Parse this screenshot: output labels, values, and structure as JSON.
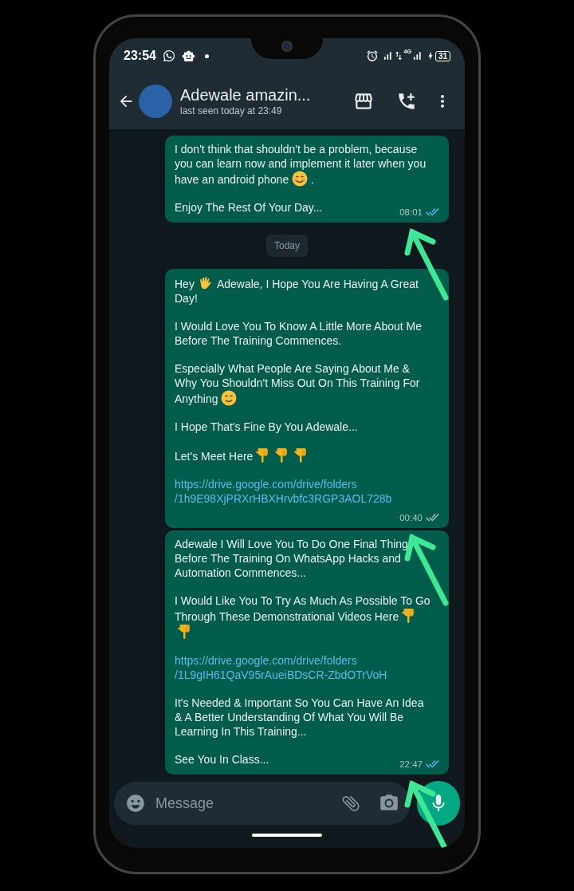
{
  "status_bar": {
    "time": "23:54",
    "network_type": "4G",
    "battery": "31"
  },
  "chat_header": {
    "contact_name": "Adewale amazin...",
    "last_seen": "last seen today at 23:49"
  },
  "messages": [
    {
      "kind": "message",
      "time": "08:01",
      "read": true,
      "paragraphs": [
        {
          "kind": "lines",
          "lines": [
            [
              {
                "kind": "text",
                "text": "I don't think that shouldn't be a problem, because"
              }
            ],
            [
              {
                "kind": "text",
                "text": "you can learn now and implement it later when you"
              }
            ],
            [
              {
                "kind": "text",
                "text": "have an android phone"
              },
              {
                "kind": "blush"
              },
              {
                "kind": "text",
                "text": "."
              }
            ]
          ]
        },
        {
          "kind": "text",
          "text": "Enjoy The Rest Of Your Day..."
        }
      ]
    },
    {
      "kind": "date",
      "label": "Today"
    },
    {
      "kind": "message",
      "time": "00:40",
      "read": false,
      "paragraphs": [
        {
          "kind": "lines",
          "lines": [
            [
              {
                "kind": "text",
                "text": "Hey"
              },
              {
                "kind": "wave"
              },
              {
                "kind": "text",
                "text": "Adewale, I Hope You Are Having A Great"
              }
            ],
            [
              {
                "kind": "text",
                "text": "Day!"
              }
            ]
          ]
        },
        {
          "kind": "text",
          "text": "I Would Love You To Know A Little More About Me Before The Training Commences."
        },
        {
          "kind": "lines",
          "lines": [
            [
              {
                "kind": "text",
                "text": "Especially What People Are Saying About Me &"
              }
            ],
            [
              {
                "kind": "text",
                "text": "Why You Shouldn't Miss Out On This Training For"
              }
            ],
            [
              {
                "kind": "text",
                "text": "Anything"
              },
              {
                "kind": "smile"
              }
            ]
          ]
        },
        {
          "kind": "text",
          "text": "I Hope That's Fine By You Adewale..."
        },
        {
          "kind": "lines",
          "lines": [
            [
              {
                "kind": "text",
                "text": "Let's Meet Here"
              },
              {
                "kind": "point"
              },
              {
                "kind": "point"
              },
              {
                "kind": "point"
              }
            ]
          ]
        },
        {
          "kind": "link",
          "lines": [
            "https://drive.google.com/drive/folders",
            "/1h9E98XjPRXrHBXHrvbfc3RGP3AOL728b"
          ]
        }
      ]
    },
    {
      "kind": "message",
      "time": "22:47",
      "read": true,
      "paragraphs": [
        {
          "kind": "text",
          "text": "Adewale I Will Love You To Do One Final Thing Before The Training On WhatsApp Hacks and Automation Commences..."
        },
        {
          "kind": "lines",
          "lines": [
            [
              {
                "kind": "text",
                "text": "I Would Like You To Try As Much As Possible To Go"
              }
            ],
            [
              {
                "kind": "text",
                "text": "Through These Demonstrational Videos Here"
              },
              {
                "kind": "point"
              }
            ],
            [
              {
                "kind": "point"
              }
            ]
          ]
        },
        {
          "kind": "link",
          "lines": [
            "https://drive.google.com/drive/folders",
            "/1L9gIH61QaV95rAueiBDsCR-ZbdOTrVoH"
          ]
        },
        {
          "kind": "text",
          "text": "It's Needed & Important So You Can Have An Idea & A Better Understanding Of What You Will Be Learning In This Training..."
        },
        {
          "kind": "text",
          "text": "See You In Class..."
        }
      ]
    }
  ],
  "composer": {
    "placeholder": "Message"
  }
}
